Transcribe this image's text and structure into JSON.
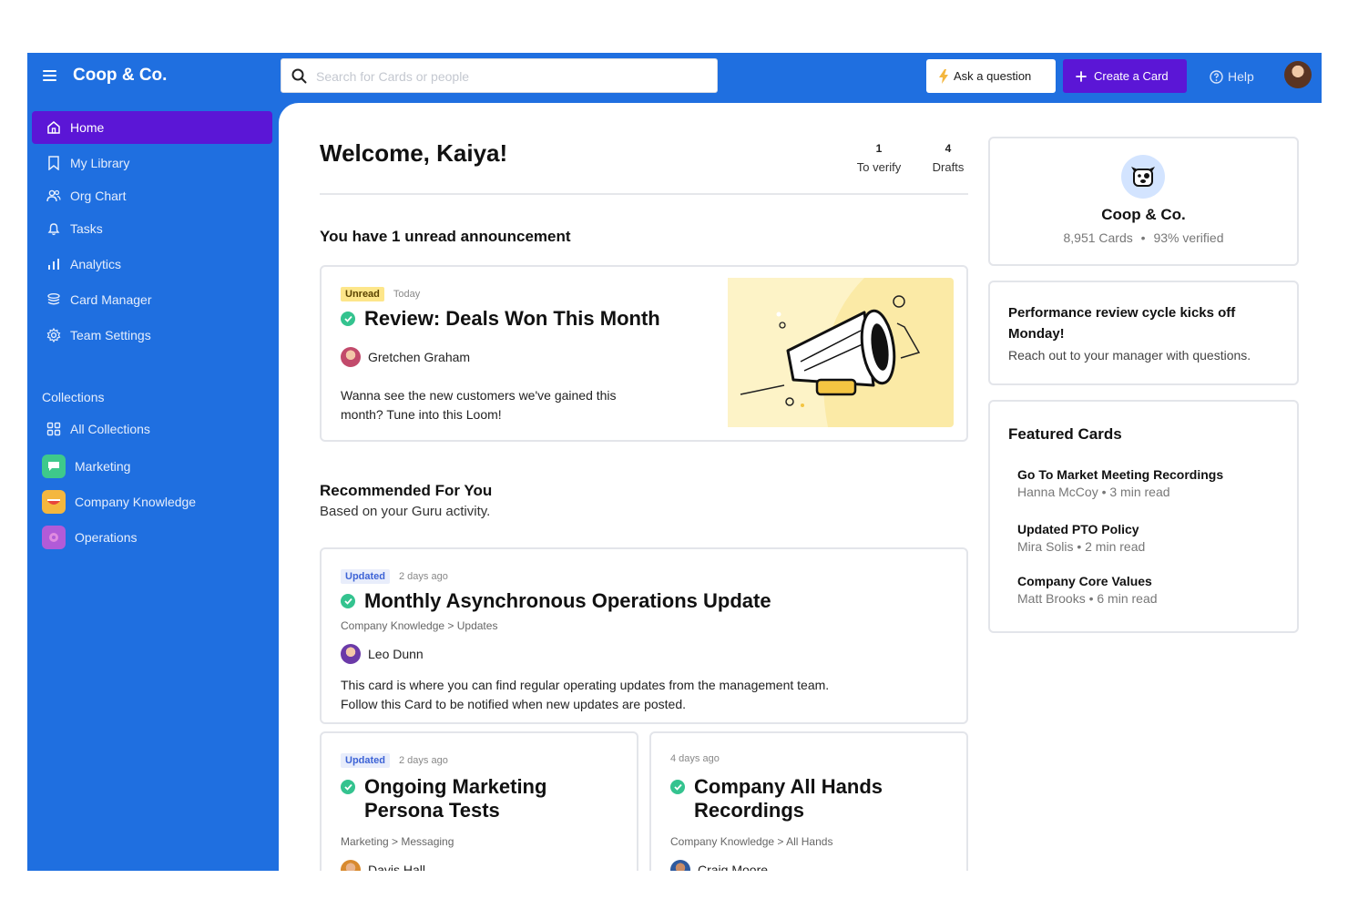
{
  "topbar": {
    "brand": "Coop & Co.",
    "search_placeholder": "Search for Cards or people",
    "ask_label": "Ask a question",
    "create_label": "Create a Card",
    "help_label": "Help"
  },
  "sidebar": {
    "items": [
      {
        "label": "Home",
        "icon": "home-icon"
      },
      {
        "label": "My Library",
        "icon": "bookmark-icon"
      },
      {
        "label": "Org Chart",
        "icon": "people-icon"
      },
      {
        "label": "Tasks",
        "icon": "bell-icon"
      },
      {
        "label": "Analytics",
        "icon": "bar-chart-icon"
      },
      {
        "label": "Card Manager",
        "icon": "stack-icon"
      },
      {
        "label": "Team Settings",
        "icon": "gear-icon"
      }
    ],
    "collections_label": "Collections",
    "collections": [
      {
        "label": "All Collections",
        "icon": "grid-icon"
      },
      {
        "label": "Marketing",
        "color": "#3ec98b"
      },
      {
        "label": "Company Knowledge",
        "color": "#f4b73f"
      },
      {
        "label": "Operations",
        "color": "#b25bd8"
      }
    ]
  },
  "main": {
    "welcome": "Welcome, Kaiya!",
    "stats": [
      {
        "num": "1",
        "label": "To verify"
      },
      {
        "num": "4",
        "label": "Drafts"
      }
    ],
    "announcement_heading": "You have 1 unread announcement",
    "announcement": {
      "tag": "Unread",
      "time": "Today",
      "title": "Review: Deals Won This Month",
      "author": "Gretchen Graham",
      "desc_1": "Wanna see the new customers we've gained this",
      "desc_2": "month? Tune into this Loom!"
    },
    "recommended_heading": "Recommended For You",
    "recommended_sub": "Based on your Guru activity.",
    "cards": [
      {
        "tag": "Updated",
        "time": "2 days ago",
        "title": "Monthly Asynchronous Operations Update",
        "crumb": "Company Knowledge > Updates",
        "author": "Leo Dunn",
        "desc_1": "This card is where you can find regular operating updates from the management team.",
        "desc_2": "Follow this Card to be notified when new updates are posted."
      },
      {
        "tag": "Updated",
        "time": "2 days ago",
        "title_1": "Ongoing Marketing",
        "title_2": "Persona Tests",
        "crumb": "Marketing > Messaging",
        "author": "Davis Hall"
      },
      {
        "time": "4 days ago",
        "title_1": "Company All Hands",
        "title_2": "Recordings",
        "crumb": "Company Knowledge > All Hands",
        "author": "Craig Moore"
      }
    ]
  },
  "right": {
    "org_name": "Coop & Co.",
    "org_cards": "8,951 Cards",
    "org_sep": "•",
    "org_verified": "93% verified",
    "announcement_title": "Performance review cycle kicks off Monday!",
    "announcement_body": "Reach out to your manager with questions.",
    "featured_heading": "Featured Cards",
    "featured": [
      {
        "title": "Go To Market Meeting Recordings",
        "meta": "Hanna McCoy • 3 min read"
      },
      {
        "title": "Updated PTO Policy",
        "meta": "Mira Solis • 2 min read"
      },
      {
        "title": "Company Core Values",
        "meta": "Matt Brooks • 6 min read"
      }
    ]
  },
  "colors": {
    "brand_blue": "#1f6fe0",
    "accent_purple": "#5b16d6",
    "verified_green": "#34c38f",
    "unread_yellow": "#fde68a"
  }
}
